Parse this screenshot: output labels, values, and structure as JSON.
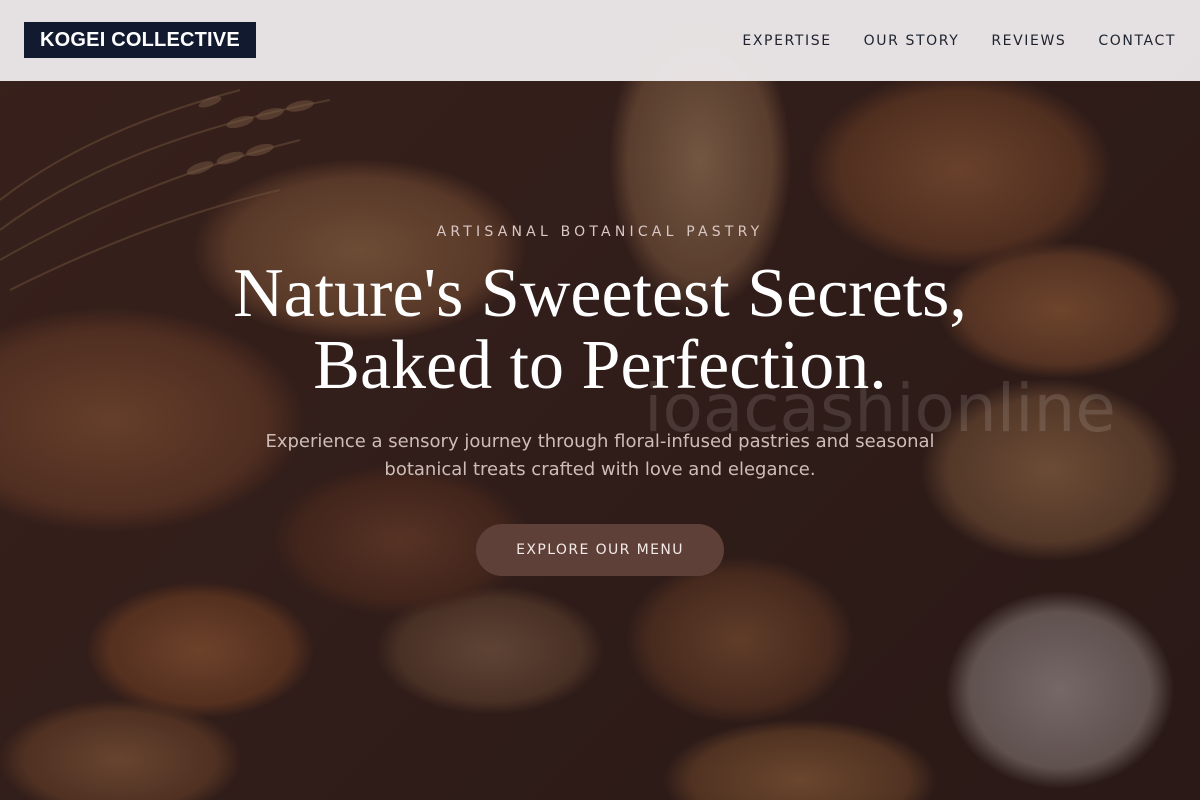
{
  "header": {
    "logo": "KOGEI COLLECTIVE",
    "nav": [
      {
        "label": "EXPERTISE"
      },
      {
        "label": "OUR STORY"
      },
      {
        "label": "REVIEWS"
      },
      {
        "label": "CONTACT"
      }
    ]
  },
  "hero": {
    "eyebrow": "ARTISANAL BOTANICAL PASTRY",
    "headline_line1": "Nature's Sweetest Secrets,",
    "headline_line2": "Baked to Perfection.",
    "subtitle": "Experience a sensory journey through floral-infused pastries and seasonal botanical treats crafted with love and elegance.",
    "cta_label": "EXPLORE OUR MENU",
    "background_image": "bread-basket-photo",
    "watermark": "ioacashionline"
  },
  "colors": {
    "logo_bg": "#111a2e",
    "header_bg": "#ece8e9",
    "cta_bg": "#5e4038",
    "headline": "#ffffff"
  }
}
